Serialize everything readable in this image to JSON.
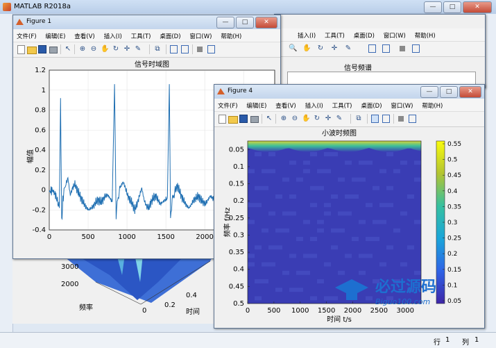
{
  "app": {
    "title": "MATLAB R2018a",
    "status_row_label": "行",
    "status_row": "1",
    "status_col_label": "列",
    "status_col": "1"
  },
  "menus": [
    "文件(F)",
    "编辑(E)",
    "查看(V)",
    "插入(I)",
    "工具(T)",
    "桌面(D)",
    "窗口(W)",
    "帮助(H)"
  ],
  "window_buttons": {
    "minimize": "—",
    "maximize": "□",
    "close": "✕"
  },
  "icons": [
    "new-figure-icon",
    "open-file-icon",
    "save-icon",
    "print-icon",
    "pointer-icon",
    "zoom-in-icon",
    "zoom-out-icon",
    "pan-icon",
    "rotate-icon",
    "data-cursor-icon",
    "brush-icon",
    "link-icon",
    "colorbar-icon",
    "legend-icon",
    "hide-plot-tools-icon",
    "show-plot-tools-icon"
  ],
  "fig1": {
    "title": "Figure 1",
    "chart_data": {
      "type": "line",
      "title": "信号时域图",
      "ylabel": "幅值",
      "xlabel": "",
      "xlim": [
        0,
        2900
      ],
      "ylim": [
        -0.4,
        1.2
      ],
      "xticks": [
        0,
        500,
        1000,
        1500,
        2000,
        2500
      ],
      "xtick_labels": [
        "0",
        "500",
        "1000",
        "1500",
        "2000",
        "2500"
      ],
      "yticks": [
        -0.4,
        -0.2,
        0,
        0.2,
        0.4,
        0.6,
        0.8,
        1,
        1.2
      ],
      "ytick_labels": [
        "-0.4",
        "-0.2",
        "0",
        "0.2",
        "0.4",
        "0.6",
        "0.8",
        "1",
        "1.2"
      ],
      "grid": true,
      "color": "#1f6fb2",
      "x": [
        0,
        40,
        80,
        110,
        130,
        145,
        160,
        175,
        190,
        210,
        240,
        270,
        300,
        330,
        360,
        390,
        420,
        450,
        480,
        510,
        540,
        570,
        600,
        630,
        660,
        690,
        720,
        750,
        780,
        810,
        840,
        860,
        880,
        900,
        920,
        950,
        980,
        1010,
        1040,
        1070,
        1100,
        1130,
        1160,
        1190,
        1220,
        1250,
        1280,
        1310,
        1340,
        1370,
        1400,
        1430,
        1460,
        1490,
        1520,
        1545,
        1560,
        1580,
        1600,
        1620,
        1650,
        1680,
        1710,
        1740,
        1770,
        1800,
        1830,
        1860,
        1890,
        1920,
        1950,
        1980,
        2010,
        2040,
        2070,
        2100,
        2130,
        2160,
        2190,
        2220,
        2250,
        2275,
        2290,
        2310,
        2330,
        2350,
        2380,
        2410,
        2440,
        2470,
        2500,
        2530,
        2560,
        2590,
        2620,
        2650,
        2680,
        2710,
        2740,
        2770,
        2800,
        2830,
        2860,
        2900
      ],
      "y": [
        -0.02,
        0.0,
        -0.05,
        -0.12,
        -0.18,
        0.92,
        -0.32,
        -0.1,
        -0.02,
        0.05,
        0.12,
        -0.05,
        0.02,
        0.06,
        0.0,
        -0.05,
        -0.1,
        -0.14,
        -0.18,
        -0.2,
        -0.18,
        -0.16,
        -0.12,
        -0.1,
        -0.12,
        -0.1,
        -0.06,
        -0.05,
        -0.08,
        -0.12,
        1.06,
        -0.25,
        -0.1,
        -0.02,
        0.04,
        0.08,
        0.02,
        -0.06,
        -0.1,
        -0.14,
        -0.2,
        -0.14,
        -0.06,
        0.02,
        -0.1,
        -0.16,
        -0.18,
        -0.12,
        -0.08,
        -0.06,
        -0.1,
        -0.14,
        -0.12,
        -0.1,
        -0.08,
        1.06,
        -0.28,
        -0.1,
        -0.06,
        0.0,
        0.04,
        -0.02,
        -0.08,
        -0.12,
        -0.16,
        -0.18,
        -0.14,
        -0.1,
        -0.08,
        -0.06,
        -0.1,
        -0.12,
        -0.14,
        -0.1,
        -0.06,
        -0.08,
        -0.1,
        -0.14,
        -0.12,
        -0.1,
        -0.08,
        1.06,
        -0.28,
        -0.12,
        -0.06,
        0.0,
        0.02,
        -0.06,
        -0.1,
        -0.14,
        -0.16,
        -0.12,
        -0.1,
        -0.08,
        -0.04,
        -0.06,
        -0.1,
        -0.12,
        -0.08,
        -0.05,
        -0.02,
        -0.04,
        -0.06,
        -0.08
      ]
    }
  },
  "fig2": {
    "chart_data": {
      "type": "line",
      "title": "信号频谱"
    }
  },
  "fig3": {
    "chart_data": {
      "type": "area",
      "xlabel": "时间",
      "ylabel": "频率",
      "x_tick_labels": [
        "0",
        "0.2",
        "0.4"
      ],
      "y_tick_labels": [
        "2000",
        "3000"
      ]
    }
  },
  "fig4": {
    "title": "Figure 4",
    "chart_data": {
      "type": "heatmap",
      "title": "小波时频图",
      "xlabel": "时间 t/s",
      "ylabel": "频率 f/Hz",
      "xlim": [
        0,
        3300
      ],
      "ylim": [
        0.5,
        0.025
      ],
      "xticks": [
        0,
        500,
        1000,
        1500,
        2000,
        2500,
        3000
      ],
      "xtick_labels": [
        "0",
        "500",
        "1000",
        "1500",
        "2000",
        "2500",
        "3000"
      ],
      "yticks": [
        0.05,
        0.1,
        0.15,
        0.2,
        0.25,
        0.3,
        0.35,
        0.4,
        0.45,
        0.5
      ],
      "ytick_labels": [
        "0.05",
        "0.1",
        "0.15",
        "0.2",
        "0.25",
        "0.3",
        "0.35",
        "0.4",
        "0.45",
        "0.5"
      ],
      "colorbar": {
        "min": 0.05,
        "max": 0.55,
        "ticks": [
          "0.55",
          "0.5",
          "0.45",
          "0.4",
          "0.35",
          "0.3",
          "0.25",
          "0.2",
          "0.15",
          "0.1",
          "0.05"
        ]
      },
      "background_color": "#3a3db4"
    }
  },
  "watermark": {
    "text": "必过源码",
    "url": "Biguo100.com"
  }
}
